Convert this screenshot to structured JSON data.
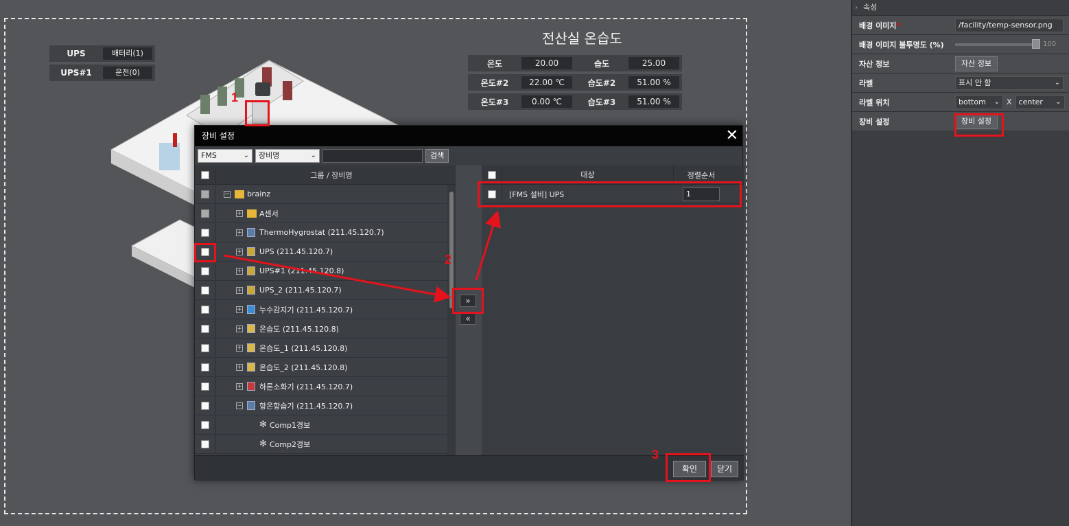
{
  "canvas": {
    "ups_labels": [
      {
        "key": "UPS",
        "value": "배터리(1)"
      },
      {
        "key": "UPS#1",
        "value": "운전(0)"
      }
    ],
    "sensor_title": "전산실 온습도",
    "sensor_rows": [
      {
        "k1": "온도",
        "v1": "20.00",
        "k2": "습도",
        "v2": "25.00"
      },
      {
        "k1": "온도#2",
        "v1": "22.00 ℃",
        "k2": "습도#2",
        "v2": "51.00 %"
      },
      {
        "k1": "온도#3",
        "v1": "0.00 ℃",
        "k2": "습도#3",
        "v2": "51.00 %"
      }
    ]
  },
  "properties": {
    "header": "속성",
    "bg_image_label": "배경 이미지",
    "bg_image_value": "/facility/temp-sensor.png",
    "bg_opacity_label": "배경 이미지 불투명도 (%)",
    "bg_opacity_value": "100",
    "bg_opacity_level": 1.0,
    "asset_label": "자산 정보",
    "asset_button": "자산 정보",
    "label_label": "라벨",
    "label_value": "표시 안 함",
    "label_pos_label": "라벨 위치",
    "label_pos_v": "bottom",
    "label_pos_sep": "X",
    "label_pos_h": "center",
    "equip_label": "장비 설정",
    "equip_button": "장비 설정"
  },
  "modal": {
    "title": "장비 설정",
    "filter_type": "FMS",
    "filter_field": "장비명",
    "search_button": "검색",
    "left_header": "그룹 / 장비명",
    "tree": [
      {
        "label": "brainz",
        "level": 0,
        "exp": "−",
        "icon": "folder-device",
        "check": "disabled"
      },
      {
        "label": "A센서",
        "level": 1,
        "exp": "+",
        "icon": "folder-device",
        "check": "disabled"
      },
      {
        "label": "ThermoHygrostat (211.45.120.7)",
        "level": 1,
        "exp": "+",
        "icon": "device",
        "check": "enabled"
      },
      {
        "label": "UPS (211.45.120.7)",
        "level": 1,
        "exp": "+",
        "icon": "ups-device",
        "check": "enabled"
      },
      {
        "label": "UPS#1 (211.45.120.8)",
        "level": 1,
        "exp": "+",
        "icon": "ups-device",
        "check": "enabled"
      },
      {
        "label": "UPS_2 (211.45.120.7)",
        "level": 1,
        "exp": "+",
        "icon": "ups-device",
        "check": "enabled"
      },
      {
        "label": "누수감지기 (211.45.120.7)",
        "level": 1,
        "exp": "+",
        "icon": "leak-device",
        "check": "enabled"
      },
      {
        "label": "온습도 (211.45.120.8)",
        "level": 1,
        "exp": "+",
        "icon": "sensor-device",
        "check": "enabled"
      },
      {
        "label": "온습도_1 (211.45.120.8)",
        "level": 1,
        "exp": "+",
        "icon": "sensor-device",
        "check": "enabled"
      },
      {
        "label": "온습도_2 (211.45.120.8)",
        "level": 1,
        "exp": "+",
        "icon": "sensor-device",
        "check": "enabled"
      },
      {
        "label": "하론소화기 (211.45.120.7)",
        "level": 1,
        "exp": "+",
        "icon": "extinguisher-device",
        "check": "enabled"
      },
      {
        "label": "항온항습기 (211.45.120.7)",
        "level": 1,
        "exp": "−",
        "icon": "device",
        "check": "enabled"
      },
      {
        "label": "Comp1경보",
        "level": 2,
        "exp": "",
        "icon": "fan",
        "check": "enabled"
      },
      {
        "label": "Comp2경보",
        "level": 2,
        "exp": "",
        "icon": "fan",
        "check": "enabled"
      }
    ],
    "move_right": "»",
    "move_left": "«",
    "right_header_target": "대상",
    "right_header_order": "정렬순서",
    "targets": [
      {
        "label": "[FMS 설비] UPS",
        "order": "1"
      }
    ],
    "confirm_button": "확인",
    "close_button": "닫기"
  },
  "annotations": {
    "step1": "1",
    "step2": "2",
    "step3": "3",
    "color": "#e4131c"
  }
}
